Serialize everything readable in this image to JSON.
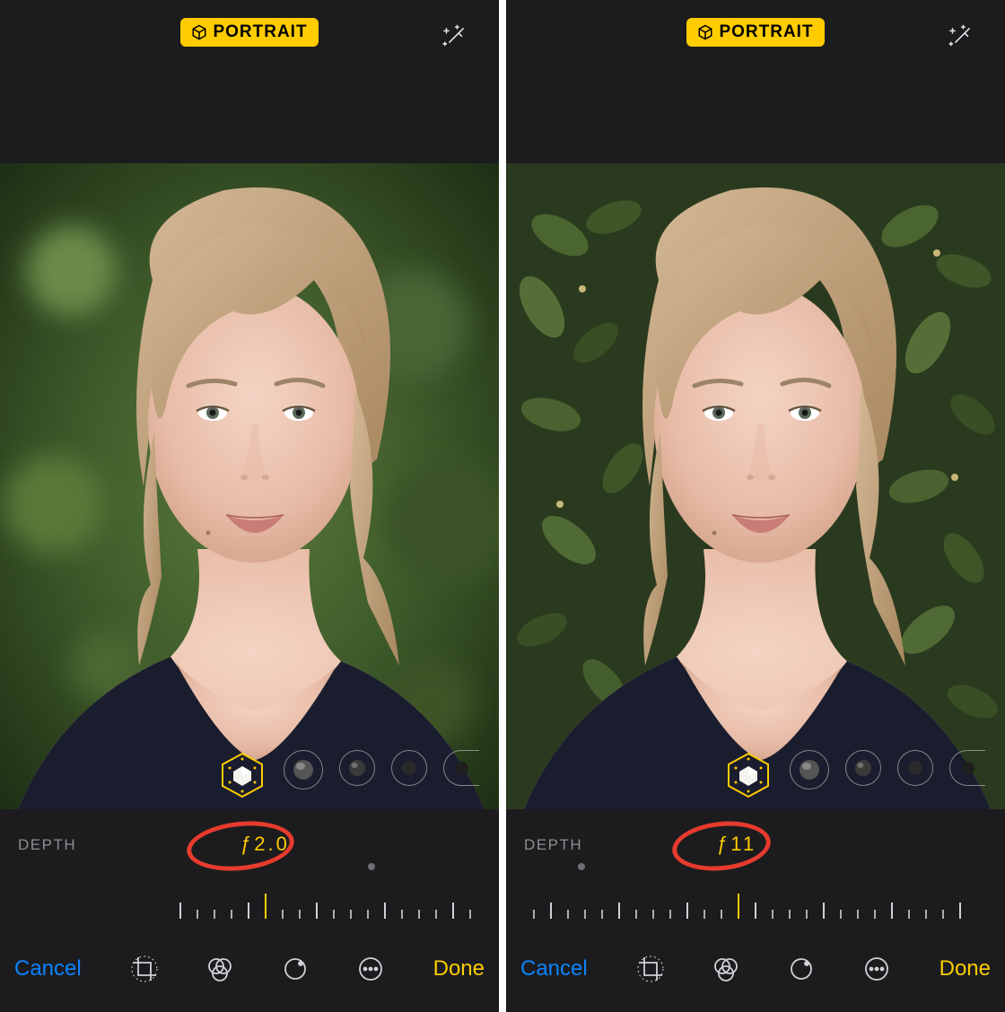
{
  "badge_label": "PORTRAIT",
  "left": {
    "depth_label": "DEPTH",
    "f_value": "ƒ2.0",
    "cancel_label": "Cancel",
    "done_label": "Done"
  },
  "right": {
    "depth_label": "DEPTH",
    "f_value": "ƒ11",
    "cancel_label": "Cancel",
    "done_label": "Done"
  },
  "colors": {
    "accent": "#ffcc00",
    "link": "#0a84ff",
    "annotation": "#e63b2e"
  }
}
